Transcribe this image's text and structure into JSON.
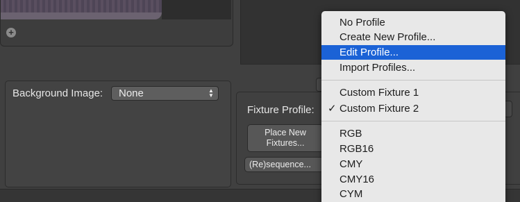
{
  "background_panel": {
    "label": "Background Image:",
    "select_value": "None",
    "select_arrows": "▲▼"
  },
  "add_button": {
    "glyph": "+"
  },
  "fixture_panel": {
    "label": "Fixture Profile:",
    "place_button": "Place New\nFixtures...",
    "resequence_button": "(Re)sequence..."
  },
  "profile_menu": {
    "groups": [
      {
        "items": [
          {
            "label": "No Profile",
            "checked": false,
            "highlighted": false
          },
          {
            "label": "Create New Profile...",
            "checked": false,
            "highlighted": false
          },
          {
            "label": "Edit Profile...",
            "checked": false,
            "highlighted": true
          },
          {
            "label": "Import Profiles...",
            "checked": false,
            "highlighted": false
          }
        ]
      },
      {
        "items": [
          {
            "label": "Custom Fixture 1",
            "checked": false,
            "highlighted": false
          },
          {
            "label": "Custom Fixture 2",
            "checked": true,
            "highlighted": false
          }
        ]
      },
      {
        "items": [
          {
            "label": "RGB",
            "checked": false,
            "highlighted": false
          },
          {
            "label": "RGB16",
            "checked": false,
            "highlighted": false
          },
          {
            "label": "CMY",
            "checked": false,
            "highlighted": false
          },
          {
            "label": "CMY16",
            "checked": false,
            "highlighted": false
          },
          {
            "label": "CYM",
            "checked": false,
            "highlighted": false
          }
        ]
      }
    ],
    "check_glyph": "✓"
  },
  "colors": {
    "highlight": "#1b62d6",
    "menu_background": "#e8e8e8",
    "window_background": "#404040"
  }
}
